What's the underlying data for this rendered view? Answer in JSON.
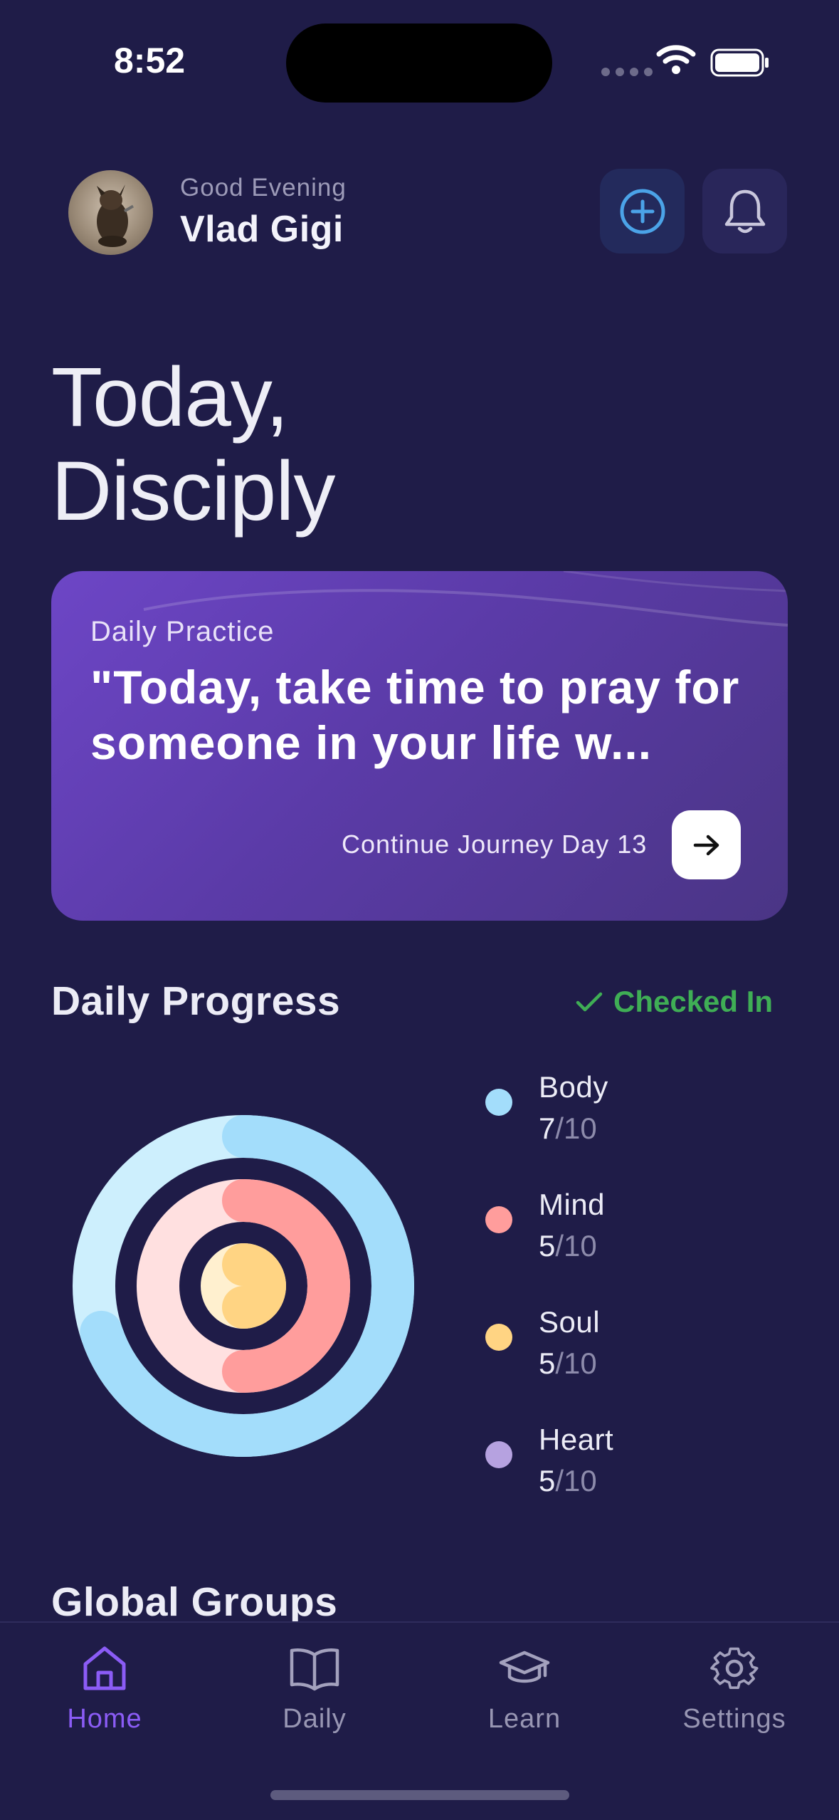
{
  "status_bar": {
    "time": "8:52"
  },
  "header": {
    "greeting": "Good Evening",
    "user_name": "Vlad Gigi",
    "add_icon": "plus-circle-icon",
    "notification_icon": "bell-icon"
  },
  "page": {
    "title_line1": "Today,",
    "title_line2": "Disciply"
  },
  "daily_practice": {
    "label": "Daily Practice",
    "quote": "\"Today, take time to pray for someone in your life w...",
    "continue_label": "Continue Journey Day 13",
    "arrow_icon": "arrow-right-icon"
  },
  "progress": {
    "title": "Daily Progress",
    "status": "Checked In",
    "status_icon": "check-icon",
    "status_color": "#3fae55",
    "items": [
      {
        "label": "Body",
        "value": "7",
        "total": "/10",
        "color": "#a3ddfb",
        "level": 0.7
      },
      {
        "label": "Mind",
        "value": "5",
        "total": "/10",
        "color": "#ff9d9c",
        "level": 0.5
      },
      {
        "label": "Soul",
        "value": "5",
        "total": "/10",
        "color": "#ffd483",
        "level": 0.5
      },
      {
        "label": "Heart",
        "value": "5",
        "total": "/10",
        "color": "#b6a2e0",
        "level": 0.5
      }
    ]
  },
  "groups": {
    "title": "Global Groups"
  },
  "nav": {
    "items": [
      {
        "label": "Home",
        "icon": "home-icon",
        "active": true
      },
      {
        "label": "Daily",
        "icon": "book-icon",
        "active": false
      },
      {
        "label": "Learn",
        "icon": "graduation-cap-icon",
        "active": false
      },
      {
        "label": "Settings",
        "icon": "gear-icon",
        "active": false
      }
    ],
    "active_color": "#8b5cf6"
  }
}
